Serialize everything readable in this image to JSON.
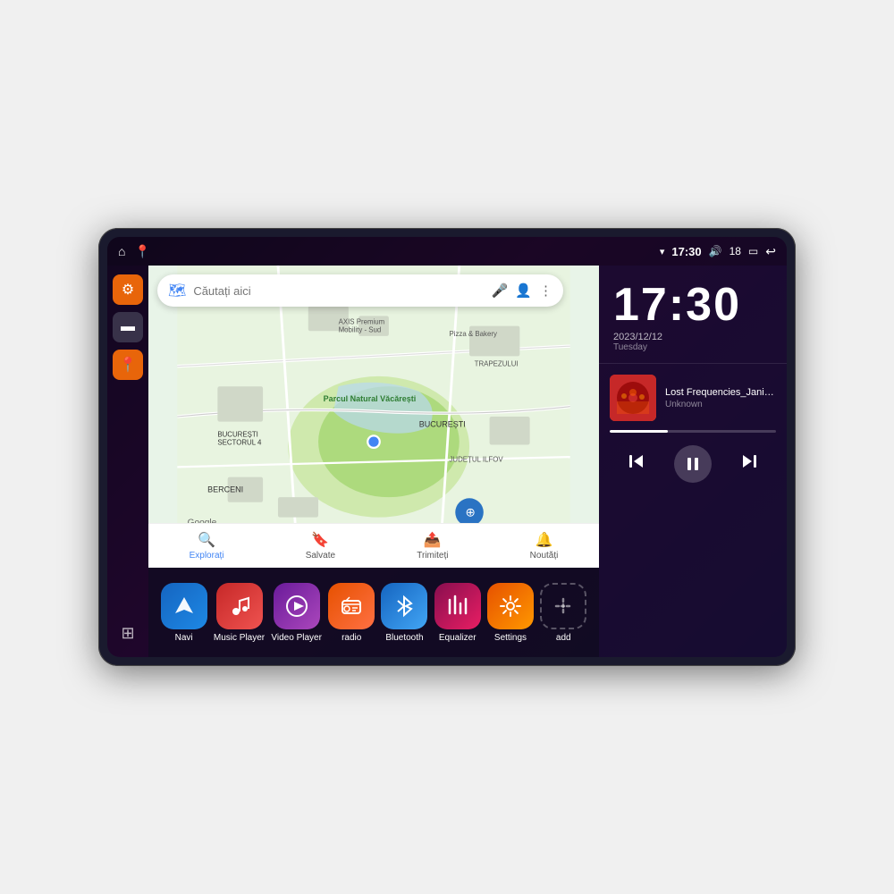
{
  "device": {
    "status_bar": {
      "left_icons": [
        "⌂",
        "📍"
      ],
      "wifi_icon": "▾",
      "time": "17:30",
      "volume_icon": "🔊",
      "battery_level": "18",
      "battery_icon": "▭",
      "back_icon": "↩"
    },
    "clock": {
      "time": "17:30",
      "date": "2023/12/12",
      "day": "Tuesday"
    },
    "music": {
      "title": "Lost Frequencies_Janie...",
      "artist": "Unknown",
      "progress": 35
    },
    "map": {
      "search_placeholder": "Căutați aici",
      "locations": [
        "AXIS Premium Mobility - Sud",
        "Pizza & Bakery",
        "Parcul Natural Văcărești",
        "BUCUREȘTI",
        "SECTORUL 4",
        "BERCENI",
        "JUDEȚUL ILFOV",
        "TRAPEZULUI"
      ],
      "bottom_tabs": [
        "Explorați",
        "Salvate",
        "Trimiteți",
        "Noutăți"
      ]
    },
    "apps": [
      {
        "label": "Navi",
        "icon_type": "navi",
        "icon": "▲"
      },
      {
        "label": "Music Player",
        "icon_type": "music",
        "icon": "♪"
      },
      {
        "label": "Video Player",
        "icon_type": "video",
        "icon": "▶"
      },
      {
        "label": "radio",
        "icon_type": "radio",
        "icon": "📻"
      },
      {
        "label": "Bluetooth",
        "icon_type": "bluetooth",
        "icon": "⚡"
      },
      {
        "label": "Equalizer",
        "icon_type": "equalizer",
        "icon": "≡"
      },
      {
        "label": "Settings",
        "icon_type": "settings",
        "icon": "⚙"
      },
      {
        "label": "add",
        "icon_type": "add",
        "icon": "+"
      }
    ],
    "sidebar": [
      {
        "icon": "⚙",
        "style": "orange"
      },
      {
        "icon": "▬",
        "style": "dark"
      },
      {
        "icon": "📍",
        "style": "orange"
      }
    ]
  }
}
